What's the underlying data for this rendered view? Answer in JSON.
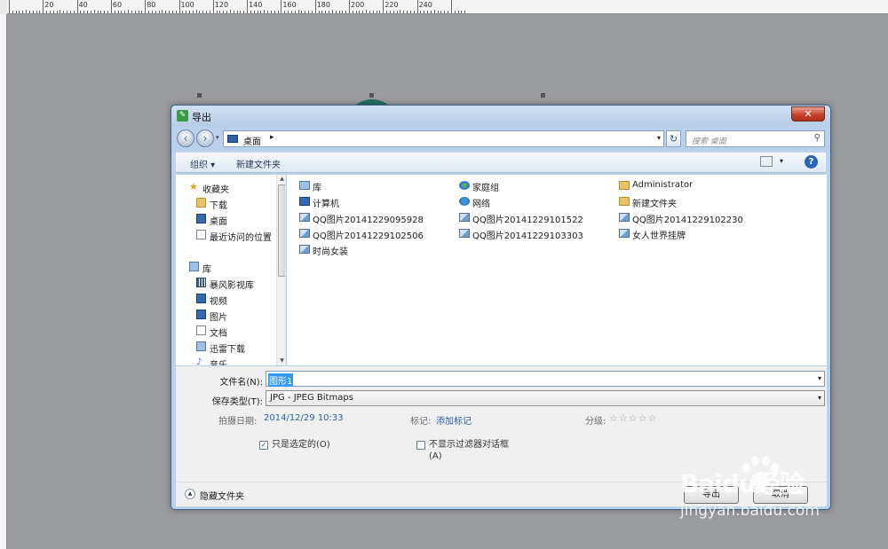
{
  "ruler": {
    "labels": [
      "20",
      "40",
      "60",
      "80",
      "100",
      "120",
      "140",
      "160",
      "180",
      "200",
      "220",
      "240"
    ]
  },
  "dialog": {
    "title": "导出",
    "close_glyph": "✕",
    "address": {
      "path": "桌面",
      "arrow": "▸",
      "search_placeholder": "搜索 桌面"
    },
    "toolbar": {
      "organize": "组织 ▾",
      "new_folder": "新建文件夹",
      "help": "?"
    },
    "nav": {
      "items": [
        {
          "label": "收藏夹",
          "icon": "star-icon"
        },
        {
          "label": "下载",
          "icon": "download-folder-icon"
        },
        {
          "label": "桌面",
          "icon": "desktop-icon"
        },
        {
          "label": "最近访问的位置",
          "icon": "recent-places-icon"
        },
        {
          "label": "库",
          "icon": "library-icon"
        },
        {
          "label": "暴风影视库",
          "icon": "video-library-icon"
        },
        {
          "label": "视频",
          "icon": "video-icon"
        },
        {
          "label": "图片",
          "icon": "pictures-icon"
        },
        {
          "label": "文档",
          "icon": "documents-icon"
        },
        {
          "label": "迅雷下载",
          "icon": "thunder-download-icon"
        },
        {
          "label": "音乐",
          "icon": "music-icon"
        }
      ]
    },
    "files": [
      {
        "label": "库",
        "icon": "library-icon"
      },
      {
        "label": "家庭组",
        "icon": "homegroup-icon"
      },
      {
        "label": "Administrator",
        "icon": "user-folder-icon"
      },
      {
        "label": "计算机",
        "icon": "computer-icon"
      },
      {
        "label": "网络",
        "icon": "network-icon"
      },
      {
        "label": "新建文件夹",
        "icon": "folder-icon"
      },
      {
        "label": "QQ图片20141229095928",
        "icon": "image-file-icon"
      },
      {
        "label": "QQ图片20141229101522",
        "icon": "image-file-icon"
      },
      {
        "label": "QQ图片20141229102230",
        "icon": "image-file-icon"
      },
      {
        "label": "QQ图片20141229102506",
        "icon": "image-file-icon"
      },
      {
        "label": "QQ图片20141229103303",
        "icon": "image-file-icon"
      },
      {
        "label": "女人世界挂牌",
        "icon": "image-file-icon"
      },
      {
        "label": "时尚女装",
        "icon": "image-file-icon"
      }
    ],
    "form": {
      "filename_label": "文件名(N):",
      "filename_value": "图形1",
      "type_label": "保存类型(T):",
      "type_value": "JPG - JPEG Bitmaps",
      "date_label": "拍摄日期:",
      "date_value": "2014/12/29 10:33",
      "tags_label": "标记:",
      "tags_value": "添加标记",
      "rating_label": "分级:",
      "rating_stars": "☆☆☆☆☆",
      "selected_only_label": "只是选定的(O)",
      "selected_only_checked": "✓",
      "no_filter_dialog_label": "不显示过滤器对话框",
      "no_filter_dialog_label_line2": "(A)"
    },
    "bottom": {
      "hide_folders": "隐藏文件夹",
      "export_button": "导出",
      "cancel_button": "取消"
    }
  },
  "watermark": {
    "logo": "Baidu经验",
    "url": "jingyan.baidu.com"
  }
}
